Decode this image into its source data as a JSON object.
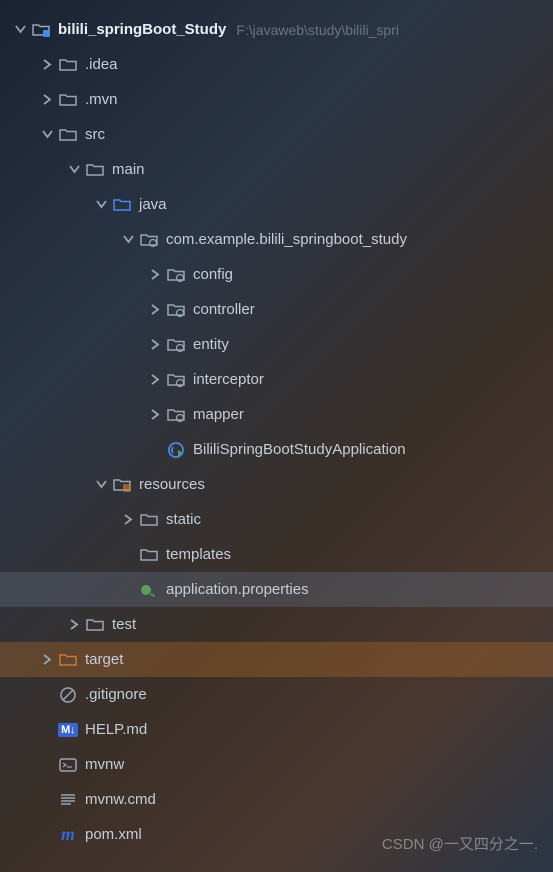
{
  "root": {
    "name": "bilili_springBoot_Study",
    "path": "F:\\javaweb\\study\\bilili_spri"
  },
  "items": {
    "idea": ".idea",
    "mvn": ".mvn",
    "src": "src",
    "main": "main",
    "java": "java",
    "pkg": "com.example.bilili_springboot_study",
    "config": "config",
    "controller": "controller",
    "entity": "entity",
    "interceptor": "interceptor",
    "mapper": "mapper",
    "appClass": "BililiSpringBootStudyApplication",
    "resources": "resources",
    "static": "static",
    "templates": "templates",
    "appProps": "application.properties",
    "test": "test",
    "target": "target",
    "gitignore": ".gitignore",
    "helpmd": "HELP.md",
    "mvnw": "mvnw",
    "mvnwcmd": "mvnw.cmd",
    "pomxml": "pom.xml"
  },
  "watermark": "CSDN @一又四分之一."
}
